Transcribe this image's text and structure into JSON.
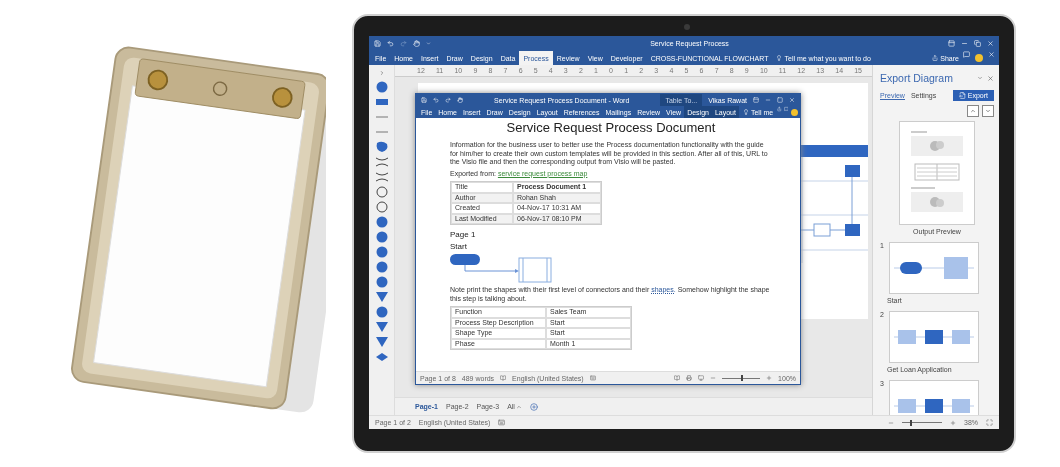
{
  "visio": {
    "title": "Service Request Process",
    "tabs": [
      {
        "label": "File",
        "selected": false
      },
      {
        "label": "Home",
        "selected": false
      },
      {
        "label": "Insert",
        "selected": false
      },
      {
        "label": "Draw",
        "selected": false
      },
      {
        "label": "Design",
        "selected": false
      },
      {
        "label": "Data",
        "selected": false
      },
      {
        "label": "Process",
        "selected": true
      },
      {
        "label": "Review",
        "selected": false
      },
      {
        "label": "View",
        "selected": false
      },
      {
        "label": "Developer",
        "selected": false
      },
      {
        "label": "CROSS-FUNCTIONAL FLOWCHART",
        "selected": false
      }
    ],
    "tell_me": "Tell me what you want to do",
    "share": "Share",
    "ruler": [
      "12",
      "11",
      "10",
      "9",
      "8",
      "7",
      "6",
      "5",
      "4",
      "3",
      "2",
      "1",
      "0",
      "1",
      "2",
      "3",
      "4",
      "5",
      "6",
      "7",
      "8",
      "9",
      "10",
      "11",
      "12",
      "13",
      "14",
      "15"
    ],
    "pages": [
      {
        "label": "Page-1",
        "selected": true
      },
      {
        "label": "Page-2",
        "selected": false
      },
      {
        "label": "Page-3",
        "selected": false
      }
    ],
    "pages_all": "All",
    "status": {
      "page": "Page 1 of 2",
      "language": "English (United States)",
      "zoom": {
        "level": 0.2,
        "reading": "38%"
      }
    }
  },
  "word": {
    "title": "Service Request Process Document - Word",
    "context_label": "Table To...",
    "user": "Vikas Rawat",
    "tabs": [
      {
        "label": "File",
        "contextual": false
      },
      {
        "label": "Home",
        "contextual": false
      },
      {
        "label": "Insert",
        "contextual": false
      },
      {
        "label": "Draw",
        "contextual": false
      },
      {
        "label": "Design",
        "contextual": false
      },
      {
        "label": "Layout",
        "contextual": false
      },
      {
        "label": "References",
        "contextual": false
      },
      {
        "label": "Mailings",
        "contextual": false
      },
      {
        "label": "Review",
        "contextual": false
      },
      {
        "label": "View",
        "contextual": false
      },
      {
        "label": "Design",
        "contextual": true
      },
      {
        "label": "Layout",
        "contextual": true
      }
    ],
    "tell_me": "Tell me",
    "heading": "Service Request Process Document",
    "intro": "Information for the business user to better use the Process documentation functionality with the guide for him/her to create their own custom templates will be provided in this section. After all of this, URL to the Visio file and then the corresponding output from Visio will be pasted.",
    "exported": {
      "label": "Exported from:",
      "link": "service request process map"
    },
    "meta_rows": [
      [
        "Title",
        "Process Document 1"
      ],
      [
        "Author",
        "Rohan Shah"
      ],
      [
        "Created",
        "04-Nov-17 10:31 AM"
      ],
      [
        "Last Modified",
        "06-Nov-17 08:10 PM"
      ]
    ],
    "page_heading": "Page 1",
    "step_heading": "Start",
    "note": {
      "before": "Note print the shapes with their first level of connectors and their ",
      "link": "shapes.",
      "after": " Somehow highlight the shape this step is talking about."
    },
    "step_rows": [
      [
        "Function",
        "Sales Team"
      ],
      [
        "Process Step Description",
        "Start"
      ],
      [
        "Shape Type",
        "Start"
      ],
      [
        "Phase",
        "Month 1"
      ]
    ],
    "status": {
      "page": "Page 1 of 8",
      "words": "489 words",
      "language": "English (United States)",
      "zoom": {
        "level": 0.5,
        "reading": "100%"
      }
    }
  },
  "export_panel": {
    "title": "Export Diagram",
    "tabs": [
      {
        "label": "Preview",
        "selected": true
      },
      {
        "label": "Settings",
        "selected": false
      }
    ],
    "export_button": "Export",
    "preview_caption": "Output Preview",
    "steps": [
      {
        "number": "1",
        "caption": "Start"
      },
      {
        "number": "2",
        "caption": "Get Loan Application"
      },
      {
        "number": "3"
      }
    ]
  }
}
